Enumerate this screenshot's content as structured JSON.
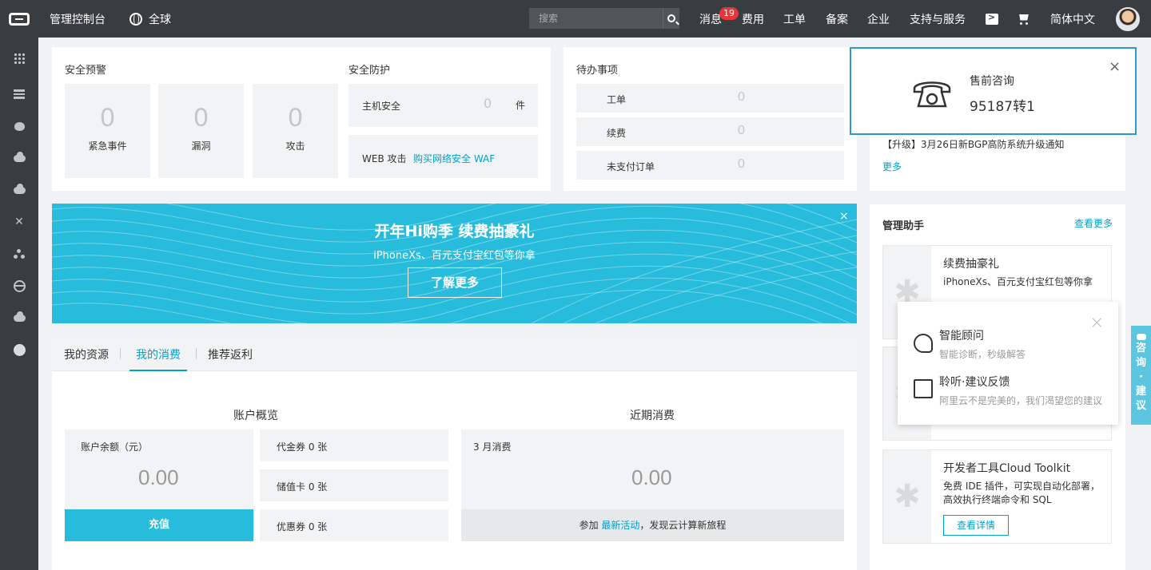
{
  "header": {
    "console_title": "管理控制台",
    "region": "全球",
    "search_placeholder": "搜索",
    "nav": {
      "messages": "消息",
      "messages_badge": "19",
      "billing": "费用",
      "tickets": "工单",
      "icp": "备案",
      "enterprise": "企业",
      "support": "支持与服务",
      "language": "简体中文"
    }
  },
  "sidebar": {
    "icons": [
      "grid-icon",
      "server-stack-icon",
      "blob-icon",
      "cloud-icon",
      "cloud-upload-icon",
      "cross-icon",
      "cluster-icon",
      "globe-icon",
      "cloud-small-icon",
      "circle-icon"
    ]
  },
  "security_alert": {
    "title": "安全预警",
    "stats": [
      {
        "value": "0",
        "label": "紧急事件"
      },
      {
        "value": "0",
        "label": "漏洞"
      },
      {
        "value": "0",
        "label": "攻击"
      }
    ]
  },
  "security_protection": {
    "title": "安全防护",
    "host_label": "主机安全",
    "host_value": "0",
    "host_unit": "件",
    "web_label": "WEB 攻击",
    "web_link": "购买网络安全 WAF"
  },
  "todo": {
    "title": "待办事项",
    "rows": [
      {
        "label": "工单",
        "value": "0"
      },
      {
        "label": "续费",
        "value": "0"
      },
      {
        "label": "未支付订单",
        "value": "0"
      }
    ]
  },
  "notice": {
    "item": "【升级】3月26日新BGP高防系统升级通知",
    "more": "更多"
  },
  "banner": {
    "title": "开年Hi购季 续费抽豪礼",
    "subtitle": "iPhoneXs、百元支付宝红包等你拿",
    "button": "了解更多",
    "close": "×"
  },
  "tabs": {
    "items": [
      "我的资源",
      "我的消费",
      "推荐返利"
    ],
    "active": "我的消费"
  },
  "account": {
    "title": "账户概览",
    "balance_label": "账户余额（元）",
    "balance_value": "0.00",
    "recharge": "充值",
    "coupons": [
      "代金券 0 张",
      "储值卡 0 张",
      "优惠券 0 张"
    ]
  },
  "recent": {
    "title": "近期消费",
    "month_label": "3 月消费",
    "value": "0.00",
    "footer_prefix": "参加",
    "footer_link": "最新活动",
    "footer_suffix": "，发现云计算新旅程"
  },
  "helper": {
    "title": "管理助手",
    "more": "查看更多",
    "tools": [
      {
        "title": "续费抽豪礼",
        "desc": "iPhoneXs、百元支付宝红包等你拿"
      },
      {
        "title": "开发者工具Cloud Toolkit",
        "desc": "免费 IDE 插件，可实现自动化部署，高效执行终端命令和 SQL",
        "button": "查看详情"
      }
    ]
  },
  "presale": {
    "title": "售前咨询",
    "phone": "95187转1",
    "close": "×"
  },
  "help_menu": {
    "close": "×",
    "items": [
      {
        "title": "智能顾问",
        "desc": "智能诊断，秒级解答"
      },
      {
        "title": "聆听·建议反馈",
        "desc": "阿里云不是完美的，我们渴望您的建议"
      }
    ]
  },
  "side_tab": {
    "label": "咨询·建议"
  },
  "colors": {
    "topbar": "#373d41",
    "accent": "#00a2ca",
    "banner": "#27bcdc",
    "presale_border": "#2a9ad2"
  }
}
